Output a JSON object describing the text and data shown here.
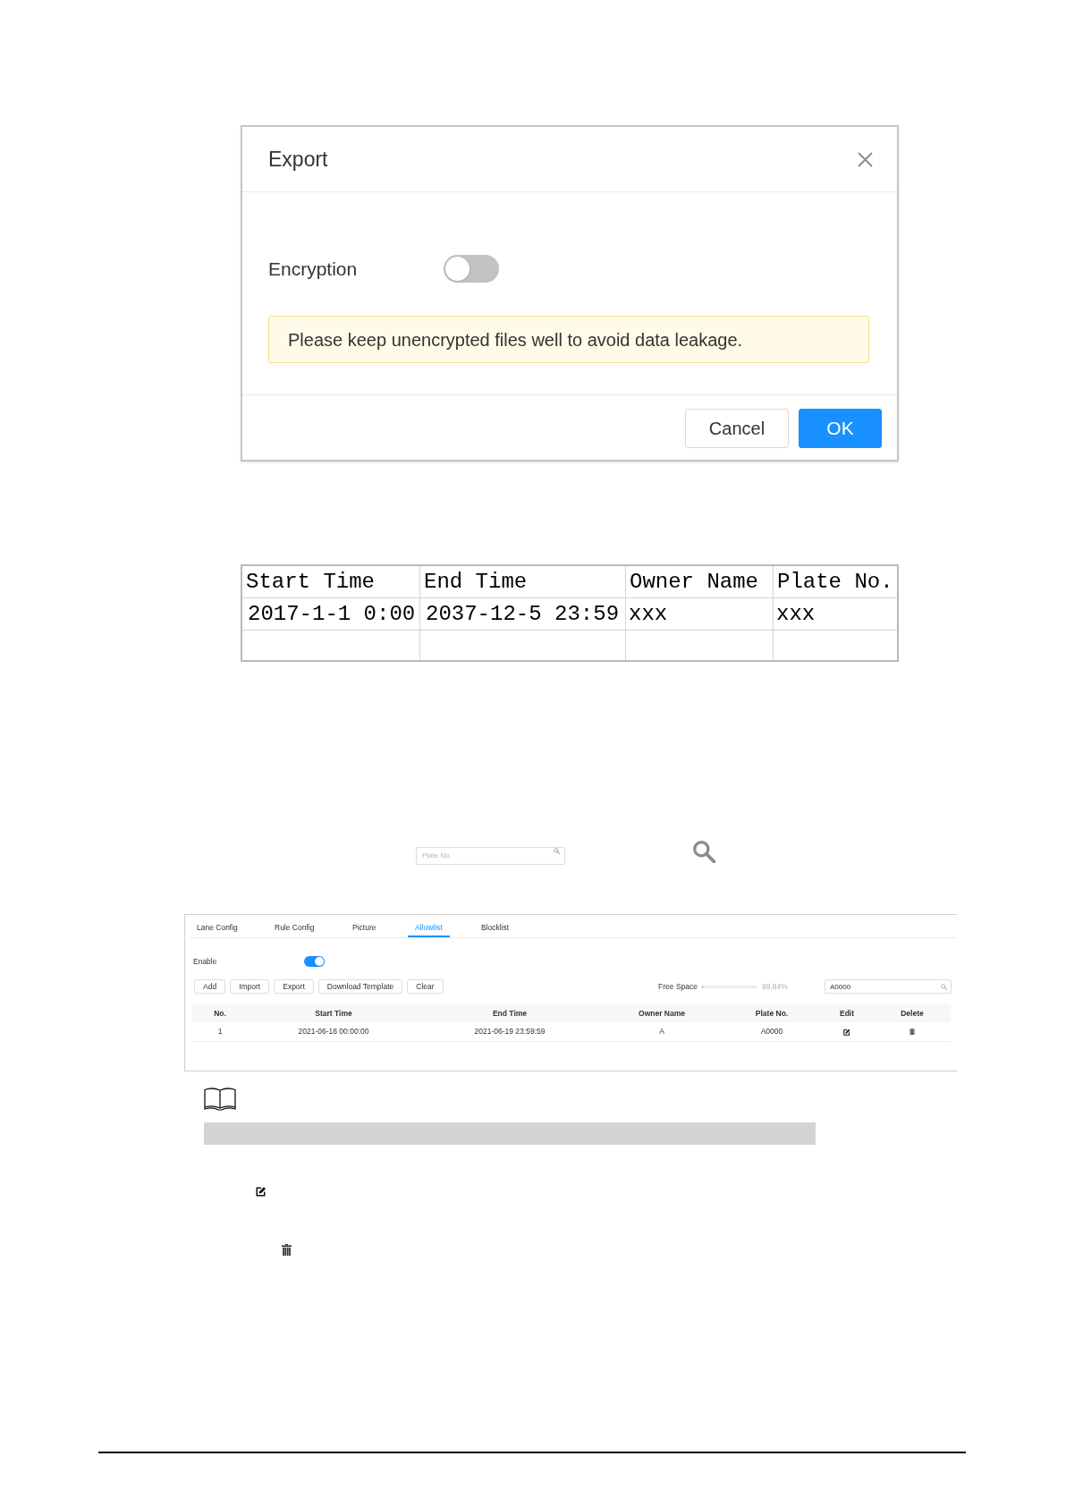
{
  "export_dialog": {
    "title": "Export",
    "encryption": {
      "label": "Encryption",
      "on": false
    },
    "warning": "Please keep unencrypted files well to avoid data leakage.",
    "buttons": [
      {
        "label": "Cancel",
        "kind": "cancel"
      },
      {
        "label": "OK",
        "kind": "confirm"
      }
    ]
  },
  "template_table": {
    "columns": [
      "Start Time",
      "End Time",
      "Owner Name",
      "Plate No."
    ],
    "rows": [
      [
        "2017-1-1 0:00",
        "2037-12-5 23:59",
        "xxx",
        "xxx"
      ]
    ]
  },
  "search": {
    "placeholder": "Plate No."
  },
  "allowlist_panel": {
    "tabs": [
      {
        "label": "Lane Config",
        "selected": false
      },
      {
        "label": "Rule Config",
        "selected": false
      },
      {
        "label": "Picture",
        "selected": false
      },
      {
        "label": "Allowlist",
        "selected": true
      },
      {
        "label": "Blocklist",
        "selected": false
      }
    ],
    "enable": {
      "label": "Enable",
      "on": true
    },
    "buttons": [
      "Add",
      "Import",
      "Export",
      "Download Template",
      "Clear"
    ],
    "free_space": {
      "label": "Free Space",
      "level": 0.02,
      "reading": "99.84%"
    },
    "search": {
      "value": "A0000"
    },
    "table": {
      "columns": [
        "No.",
        "Start Time",
        "End Time",
        "Owner Name",
        "Plate No.",
        "Edit",
        "Delete"
      ],
      "rows": [
        {
          "cells": [
            "1",
            "2021-06-18 00:00:00",
            "2021-06-19 23:59:59",
            "A",
            "A0000"
          ]
        }
      ]
    }
  }
}
